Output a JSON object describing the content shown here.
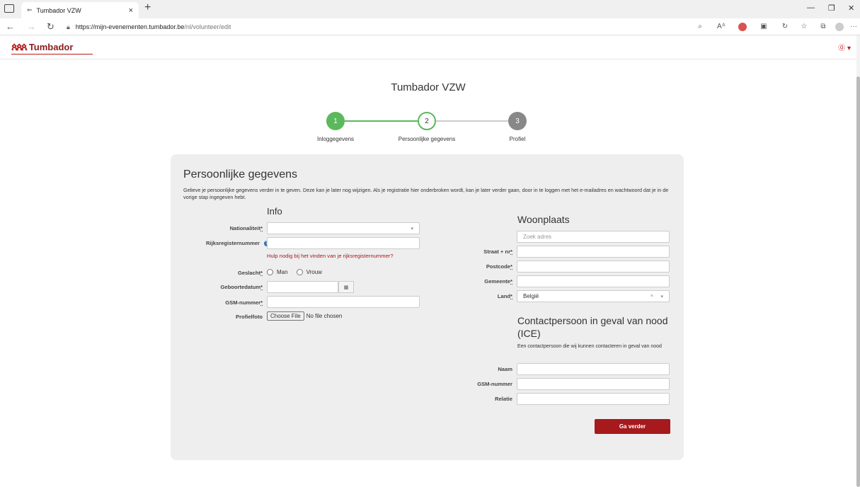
{
  "browser": {
    "tab_title": "Tumbador VZW",
    "url_base": "https://mijn-evenementen.tumbador.be",
    "url_path": "/nl/volunteer/edit",
    "new_tab": "+",
    "close_tab": "×",
    "more": "···"
  },
  "header": {
    "logo_text": "Tumbador",
    "user_menu": "⓪ ▾"
  },
  "page": {
    "org_title": "Tumbador VZW"
  },
  "steps": [
    {
      "number": "1",
      "label": "Inloggegevens",
      "state": "done"
    },
    {
      "number": "2",
      "label": "Persoonlijke gegevens",
      "state": "active"
    },
    {
      "number": "3",
      "label": "Profiel",
      "state": "todo"
    }
  ],
  "form": {
    "title": "Persoonlijke gegevens",
    "intro": "Gelieve je persoonlijke gegevens verder in te geven. Deze kan je later nog wijzigen. Als je registratie hier onderbroken wordt, kan je later verder gaan, door in te loggen met het e-mailadres en wachtwoord dat je in de vorige stap ingegeven hebt.",
    "info": {
      "title": "Info",
      "nationality_label": "Nationaliteit",
      "nationality_value": "",
      "rrn_label": "Rijksregisternummer",
      "rrn_value": "",
      "rrn_help": "Hulp nodig bij het vinden van je rijksregisternummer?",
      "gender_label": "Geslacht",
      "gender_options": [
        "Man",
        "Vrouw"
      ],
      "birthdate_label": "Geboortedatum",
      "birthdate_value": "",
      "gsm_label": "GSM-nummer",
      "gsm_value": "",
      "photo_label": "Profielfoto",
      "photo_button": "Choose File",
      "photo_status": "No file chosen"
    },
    "residence": {
      "title": "Woonplaats",
      "search_placeholder": "Zoek adres",
      "street_label": "Straat + nr",
      "postcode_label": "Postcode",
      "city_label": "Gemeente",
      "country_label": "Land",
      "country_value": "België"
    },
    "ice": {
      "title": "Contactpersoon in geval van nood (ICE)",
      "description": "Een contactpersoon die wij kunnen contacteren in geval van nood",
      "name_label": "Naam",
      "gsm_label": "GSM-nummer",
      "relation_label": "Relatie"
    },
    "required_mark": "*",
    "submit_label": "Ga verder"
  },
  "colors": {
    "brand": "#a6191c",
    "step_done": "#5cb85c",
    "step_todo": "#888888",
    "card_bg": "#eeeeee"
  }
}
